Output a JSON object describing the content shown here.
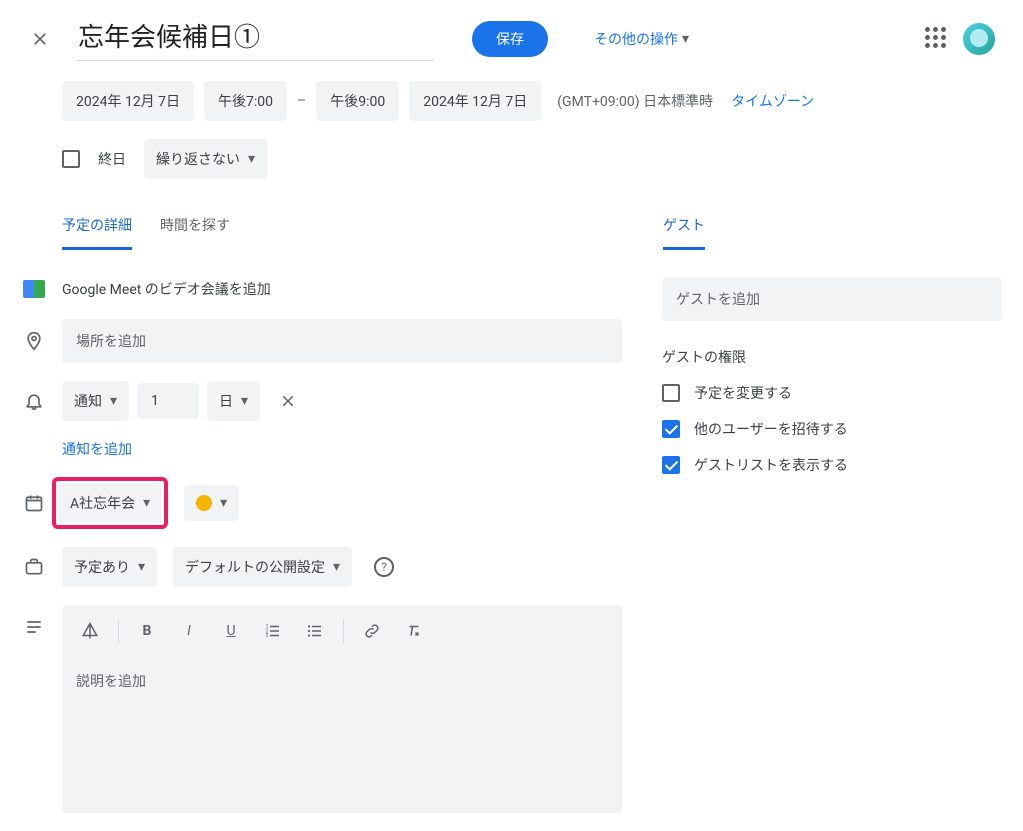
{
  "title": "忘年会候補日①",
  "save_label": "保存",
  "more_actions_label": "その他の操作",
  "datetime": {
    "start_date": "2024年 12月 7日",
    "start_time": "午後7:00",
    "separator": "–",
    "end_time": "午後9:00",
    "end_date": "2024年 12月 7日",
    "timezone_text": "(GMT+09:00) 日本標準時",
    "timezone_link": "タイムゾーン"
  },
  "allday_label": "終日",
  "recurrence_label": "繰り返さない",
  "tabs": {
    "details": "予定の詳細",
    "find_time": "時間を探す"
  },
  "meet_label": "Google Meet のビデオ会議を追加",
  "location_placeholder": "場所を追加",
  "notification": {
    "type": "通知",
    "value": "1",
    "unit": "日",
    "add_link": "通知を追加"
  },
  "calendar_name": "A社忘年会",
  "availability_label": "予定あり",
  "visibility_label": "デフォルトの公開設定",
  "description_placeholder": "説明を追加",
  "guests": {
    "title": "ゲスト",
    "add_placeholder": "ゲストを追加",
    "permissions_title": "ゲストの権限",
    "modify_event": "予定を変更する",
    "invite_others": "他のユーザーを招待する",
    "see_guest_list": "ゲストリストを表示する"
  }
}
